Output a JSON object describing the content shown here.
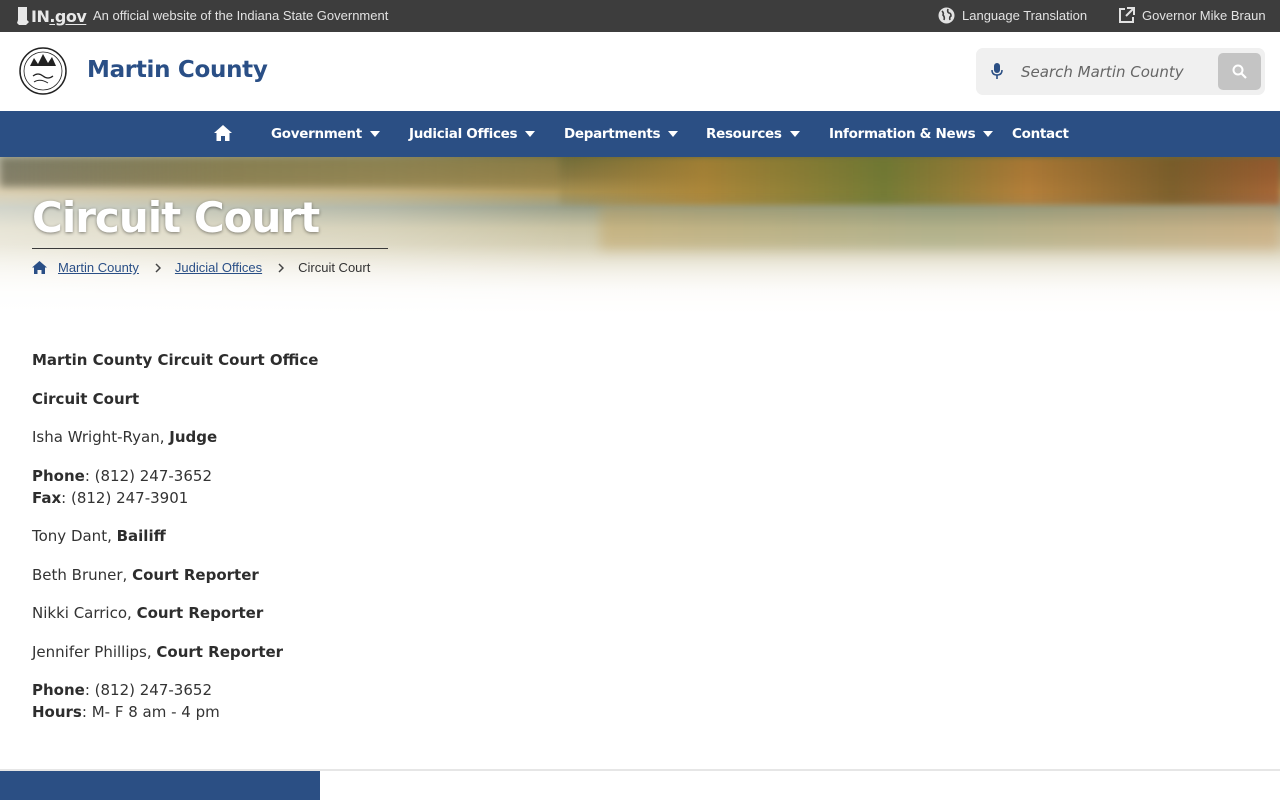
{
  "statebar": {
    "logo_in": "IN",
    "logo_gov": ".gov",
    "official_text": "An official website of the Indiana State Government",
    "language_label": "Language Translation",
    "governor_label": "Governor Mike Braun"
  },
  "header": {
    "title": "Martin County",
    "search_placeholder": "Search Martin County"
  },
  "nav": {
    "items": [
      {
        "label": "Government"
      },
      {
        "label": "Judicial Offices"
      },
      {
        "label": "Departments"
      },
      {
        "label": "Resources"
      },
      {
        "label": "Information & News"
      },
      {
        "label": "Contact"
      }
    ]
  },
  "hero": {
    "title": "Circuit Court",
    "breadcrumb": [
      "Martin County",
      "Judicial Offices",
      "Circuit Court"
    ]
  },
  "content": {
    "office_heading": "Martin County Circuit Court Office",
    "court_heading": "Circuit Court",
    "judge_name": "Isha Wright-Ryan, ",
    "judge_title": "Judge",
    "phone_label": "Phone",
    "phone_value": ": (812) 247-3652",
    "fax_label": "Fax",
    "fax_value": ": (812) 247-3901",
    "bailiff_name": "Tony Dant, ",
    "bailiff_title": "Bailiff",
    "reporter1_name": "Beth Bruner, ",
    "reporter2_name": "Nikki Carrico, ",
    "reporter3_name": "Jennifer Phillips, ",
    "reporter_title": "Court Reporter",
    "phone2_label": "Phone",
    "phone2_value": ": (812) 247-3652",
    "hours_label": "Hours",
    "hours_value": ": M- F 8 am - 4 pm"
  },
  "colors": {
    "brand_blue": "#2b4f84",
    "state_bar": "#3d3d3d"
  },
  "icons": [
    "in-logo-icon",
    "globe-icon",
    "external-link-icon",
    "county-seal",
    "microphone-icon",
    "search-icon",
    "home-icon",
    "chevron-right-icon",
    "caret-down-icon"
  ]
}
